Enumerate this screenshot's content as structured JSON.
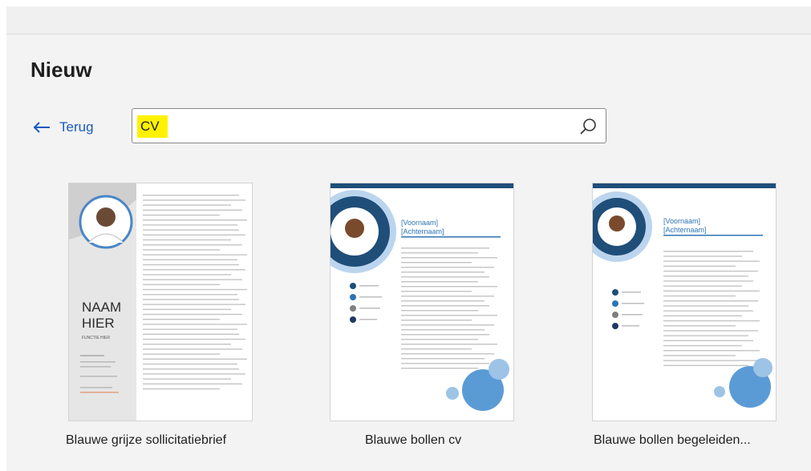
{
  "page": {
    "title": "Nieuw",
    "back_label": "Terug"
  },
  "search": {
    "value": "CV"
  },
  "icons": {
    "back": "arrow-left-icon",
    "search": "search-icon"
  },
  "colors": {
    "accent": "#185abd",
    "highlight": "#fff200",
    "template_blue": "#1f4e79"
  },
  "templates": [
    {
      "label": "Blauwe grijze sollicitatiebrief",
      "name_line1": "NAAM",
      "name_line2": "HIER",
      "job_title": "FUNCTIE HIER"
    },
    {
      "label": "Blauwe bollen cv",
      "name_line1": "[Voornaam]",
      "name_line2": "[Achternaam]"
    },
    {
      "label": "Blauwe bollen begeleiden...",
      "name_line1": "[Voornaam]",
      "name_line2": "[Achternaam]"
    }
  ]
}
